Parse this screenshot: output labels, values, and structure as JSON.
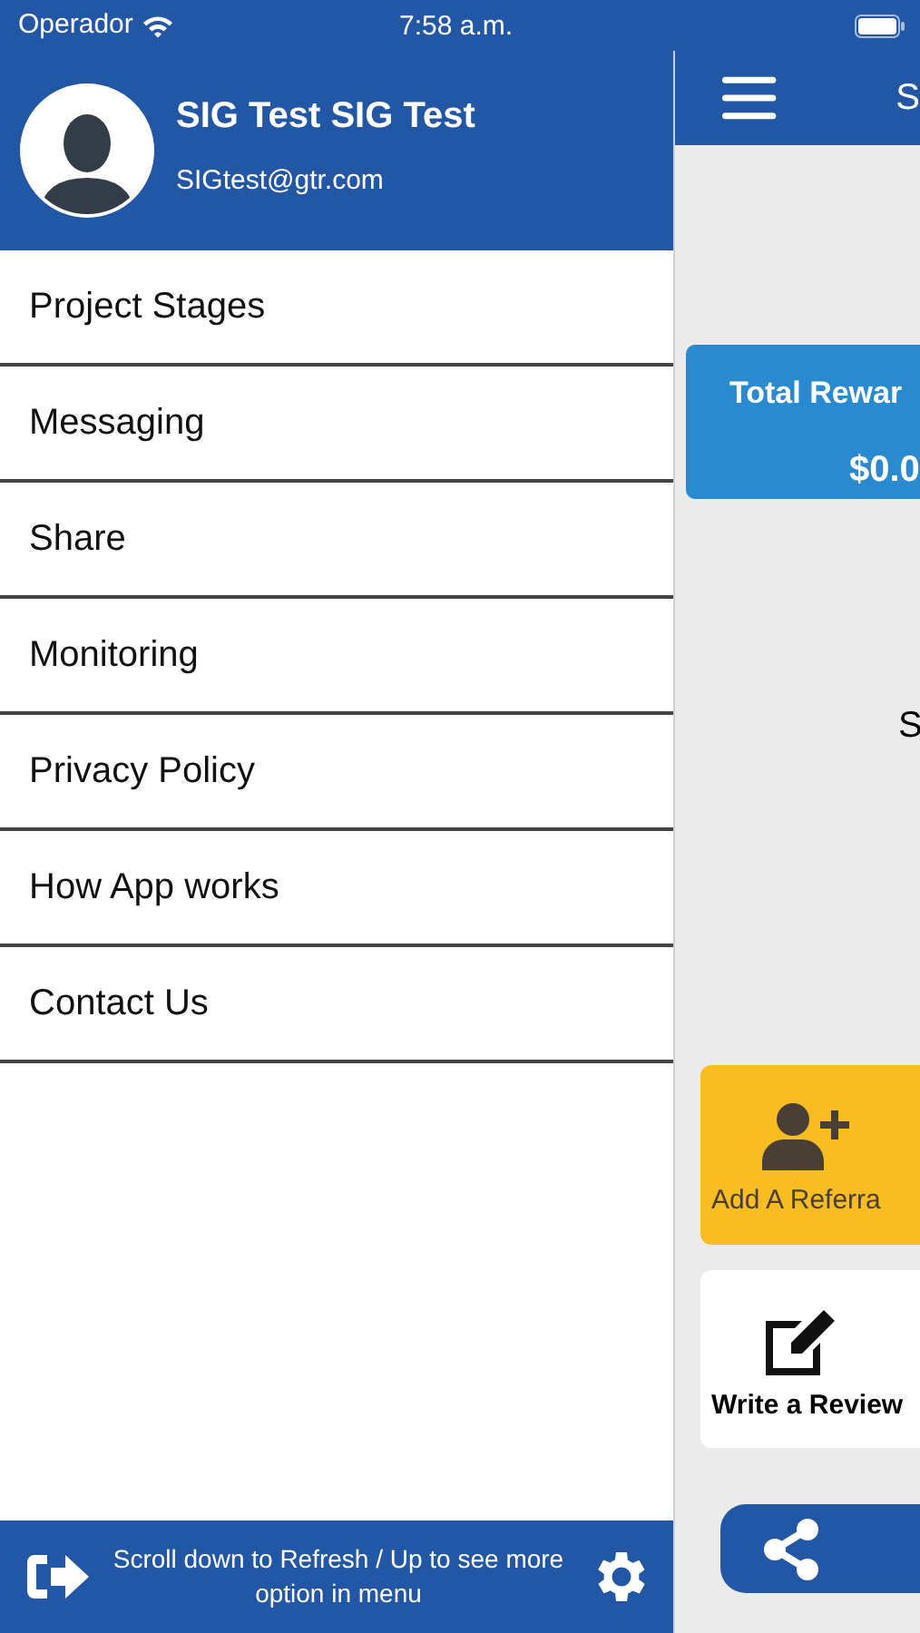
{
  "status_bar": {
    "carrier": "Operador",
    "time": "7:58 a.m."
  },
  "drawer": {
    "user_name": "SIG Test SIG Test",
    "email": "SIGtest@gtr.com",
    "menu": [
      {
        "label": "Project Stages"
      },
      {
        "label": "Messaging"
      },
      {
        "label": "Share"
      },
      {
        "label": "Monitoring"
      },
      {
        "label": "Privacy Policy"
      },
      {
        "label": "How App works"
      },
      {
        "label": "Contact Us"
      }
    ],
    "footer_text": "Scroll down to Refresh / Up to see more option in menu"
  },
  "main": {
    "header_title": "S",
    "rewards_card": {
      "title": "Total Rewar",
      "amount": "$0.0"
    },
    "middle_text": "S",
    "actions": [
      {
        "kind": "referral",
        "label": "Add A Referra"
      },
      {
        "kind": "review",
        "label": "Write a Review"
      }
    ]
  }
}
